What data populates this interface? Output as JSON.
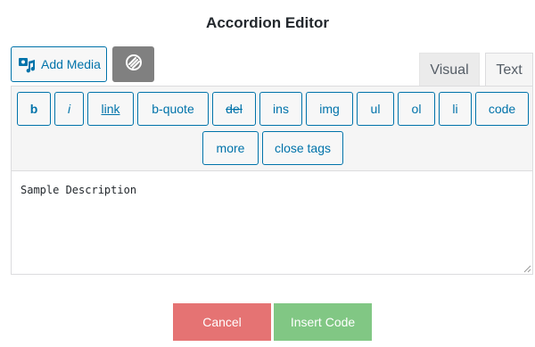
{
  "dialog": {
    "title": "Accordion Editor"
  },
  "media": {
    "add_media_label": "Add Media",
    "icon": "add-media-icon"
  },
  "plugin_button": {
    "icon": "wp-link-icon",
    "color": "#808080"
  },
  "tabs": {
    "visual_label": "Visual",
    "text_label": "Text",
    "active": "Text"
  },
  "quicktags": {
    "b": "b",
    "i": "i",
    "link": "link",
    "bquote": "b-quote",
    "del": "del",
    "ins": "ins",
    "img": "img",
    "ul": "ul",
    "ol": "ol",
    "li": "li",
    "code": "code",
    "more": "more",
    "close_tags": "close tags"
  },
  "editor": {
    "content": "Sample Description"
  },
  "actions": {
    "cancel_label": "Cancel",
    "insert_label": "Insert Code",
    "cancel_color": "#e57373",
    "insert_color": "#81c784"
  },
  "colors": {
    "accent": "#0073aa"
  }
}
